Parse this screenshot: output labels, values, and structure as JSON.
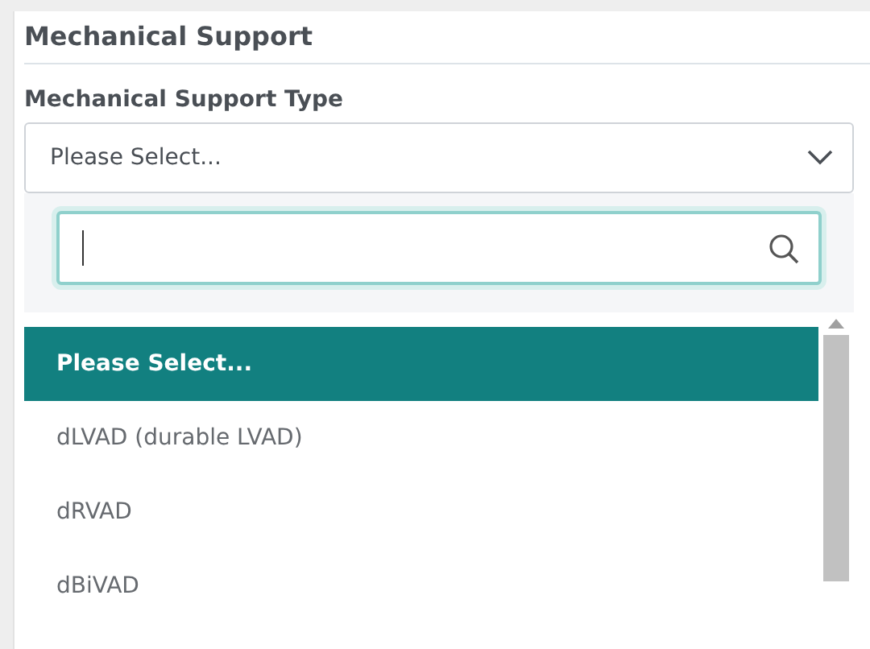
{
  "section": {
    "title": "Mechanical Support"
  },
  "field": {
    "label": "Mechanical Support Type",
    "value": "Please Select...",
    "expanded": true
  },
  "dropdown": {
    "options": [
      {
        "label": "Please Select...",
        "selected": true
      },
      {
        "label": "dLVAD (durable LVAD)",
        "selected": false
      },
      {
        "label": "dRVAD",
        "selected": false
      },
      {
        "label": "dBiVAD",
        "selected": false
      }
    ]
  }
}
